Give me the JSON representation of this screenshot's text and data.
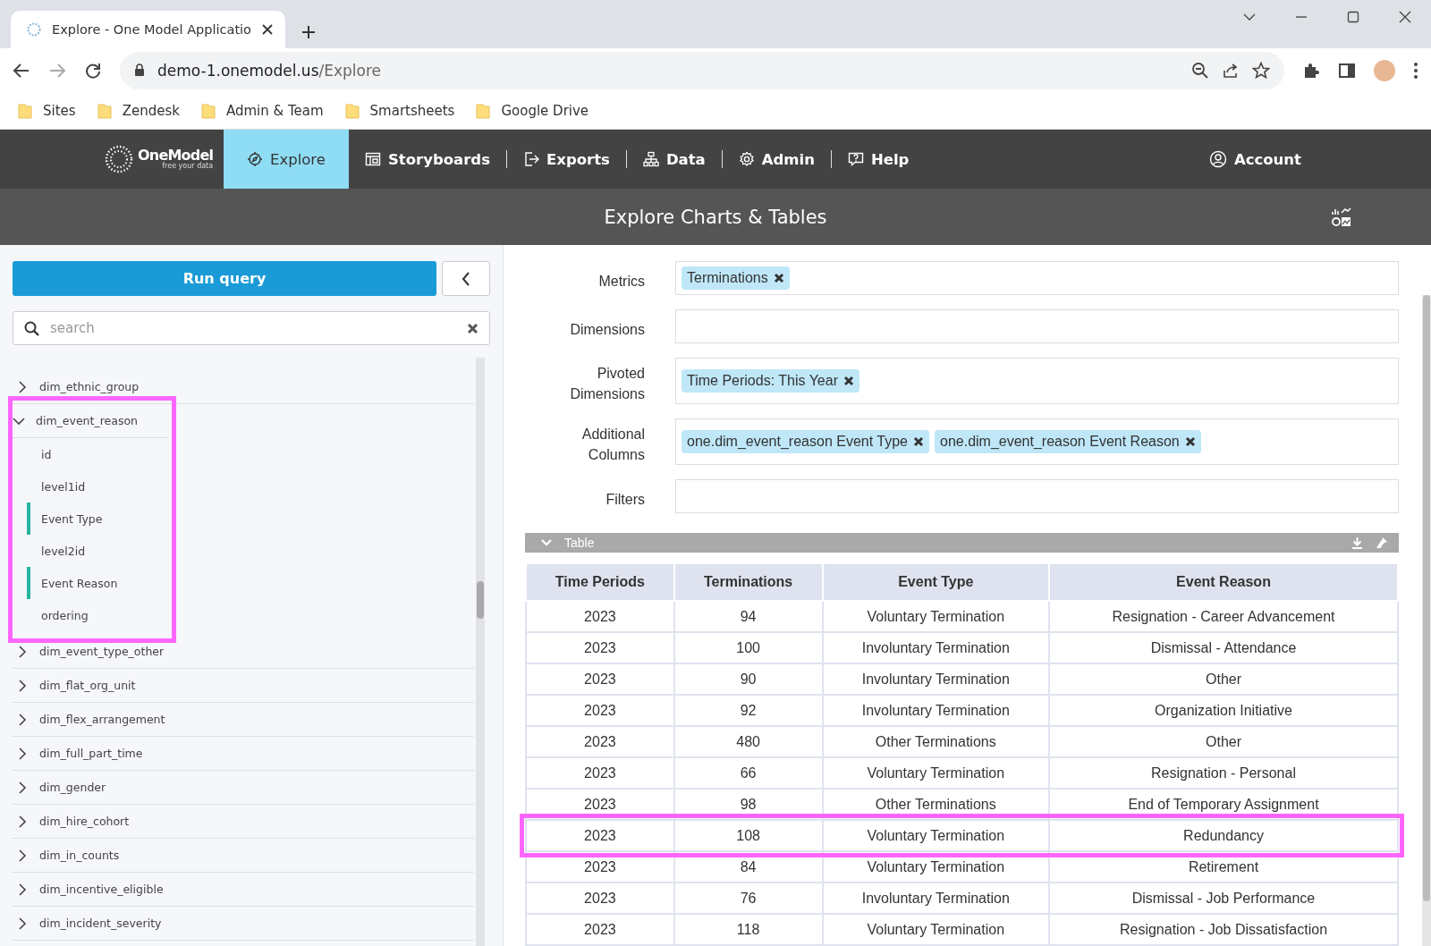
{
  "browser": {
    "tab_title": "Explore - One Model Applicatio",
    "url_host": "demo-1.onemodel.us",
    "url_path": "/Explore",
    "bookmarks": [
      "Sites",
      "Zendesk",
      "Admin & Team",
      "Smartsheets",
      "Google Drive"
    ]
  },
  "nav": {
    "logo": "OneModel",
    "tagline": "free your data",
    "items": [
      {
        "label": "Explore",
        "selected": true
      },
      {
        "label": "Storyboards",
        "selected": false
      },
      {
        "label": "Exports",
        "selected": false
      },
      {
        "label": "Data",
        "selected": false
      },
      {
        "label": "Admin",
        "selected": false
      },
      {
        "label": "Help",
        "selected": false
      }
    ],
    "account": "Account"
  },
  "page_title": "Explore Charts & Tables",
  "sidebar": {
    "run_button": "Run query",
    "search": {
      "placeholder": "search"
    },
    "tree": [
      {
        "label": "dim_ethnic_group",
        "expanded": false,
        "highlighted": false
      },
      {
        "label": "dim_event_reason",
        "expanded": true,
        "highlighted": true,
        "children": [
          {
            "label": "id",
            "in_use": false
          },
          {
            "label": "level1id",
            "in_use": false
          },
          {
            "label": "Event Type",
            "in_use": true
          },
          {
            "label": "level2id",
            "in_use": false
          },
          {
            "label": "Event Reason",
            "in_use": true
          },
          {
            "label": "ordering",
            "in_use": false
          }
        ]
      },
      {
        "label": "dim_event_type_other",
        "expanded": false,
        "highlighted": false
      },
      {
        "label": "dim_flat_org_unit",
        "expanded": false,
        "highlighted": false
      },
      {
        "label": "dim_flex_arrangement",
        "expanded": false,
        "highlighted": false
      },
      {
        "label": "dim_full_part_time",
        "expanded": false,
        "highlighted": false
      },
      {
        "label": "dim_gender",
        "expanded": false,
        "highlighted": false
      },
      {
        "label": "dim_hire_cohort",
        "expanded": false,
        "highlighted": false
      },
      {
        "label": "dim_in_counts",
        "expanded": false,
        "highlighted": false
      },
      {
        "label": "dim_incentive_eligible",
        "expanded": false,
        "highlighted": false
      },
      {
        "label": "dim_incident_severity",
        "expanded": false,
        "highlighted": false
      }
    ]
  },
  "query": {
    "fields": [
      {
        "label": "Metrics",
        "tags": [
          "Terminations"
        ]
      },
      {
        "label": "Dimensions"
      },
      {
        "label": "Pivoted Dimensions",
        "tags": [
          "Time Periods: This Year"
        ]
      },
      {
        "label": "Additional Columns",
        "tags": [
          "one.dim_event_reason Event Type",
          "one.dim_event_reason Event Reason"
        ]
      },
      {
        "label": "Filters"
      }
    ]
  },
  "table_panel": {
    "title": "Table",
    "expanded": true,
    "columns": [
      "Time Periods",
      "Terminations",
      "Event Type",
      "Event Reason"
    ],
    "rows": [
      {
        "cells": [
          "2023",
          "94",
          "Voluntary Termination",
          "Resignation - Career Advancement"
        ],
        "highlighted": false
      },
      {
        "cells": [
          "2023",
          "100",
          "Involuntary Termination",
          "Dismissal - Attendance"
        ],
        "highlighted": false
      },
      {
        "cells": [
          "2023",
          "90",
          "Involuntary Termination",
          "Other"
        ],
        "highlighted": false
      },
      {
        "cells": [
          "2023",
          "92",
          "Involuntary Termination",
          "Organization Initiative"
        ],
        "highlighted": false
      },
      {
        "cells": [
          "2023",
          "480",
          "Other Terminations",
          "Other"
        ],
        "highlighted": false
      },
      {
        "cells": [
          "2023",
          "66",
          "Voluntary Termination",
          "Resignation - Personal"
        ],
        "highlighted": false
      },
      {
        "cells": [
          "2023",
          "98",
          "Other Terminations",
          "End of Temporary Assignment"
        ],
        "highlighted": false
      },
      {
        "cells": [
          "2023",
          "108",
          "Voluntary Termination",
          "Redundancy"
        ],
        "highlighted": true
      },
      {
        "cells": [
          "2023",
          "84",
          "Voluntary Termination",
          "Retirement"
        ],
        "highlighted": false
      },
      {
        "cells": [
          "2023",
          "76",
          "Involuntary Termination",
          "Dismissal - Job Performance"
        ],
        "highlighted": false
      },
      {
        "cells": [
          "2023",
          "118",
          "Voluntary Termination",
          "Resignation - Job Dissatisfaction"
        ],
        "highlighted": false
      }
    ]
  }
}
